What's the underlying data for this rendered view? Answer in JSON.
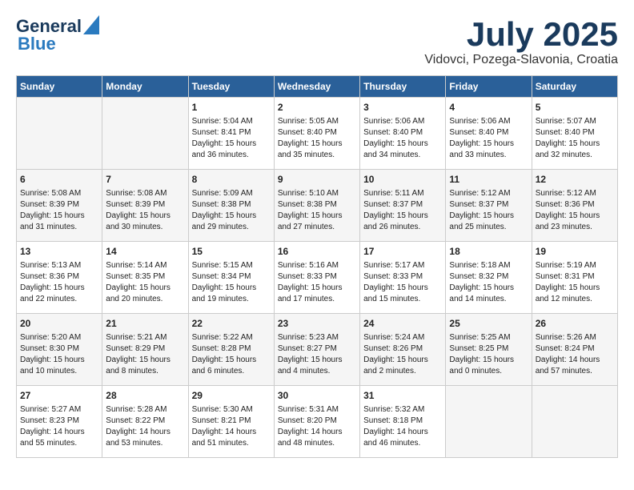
{
  "header": {
    "logo_line1": "General",
    "logo_line2": "Blue",
    "month_year": "July 2025",
    "location": "Vidovci, Pozega-Slavonia, Croatia"
  },
  "days_of_week": [
    "Sunday",
    "Monday",
    "Tuesday",
    "Wednesday",
    "Thursday",
    "Friday",
    "Saturday"
  ],
  "weeks": [
    [
      {
        "day": "",
        "empty": true
      },
      {
        "day": "",
        "empty": true
      },
      {
        "day": "1",
        "sunrise": "Sunrise: 5:04 AM",
        "sunset": "Sunset: 8:41 PM",
        "daylight": "Daylight: 15 hours and 36 minutes."
      },
      {
        "day": "2",
        "sunrise": "Sunrise: 5:05 AM",
        "sunset": "Sunset: 8:40 PM",
        "daylight": "Daylight: 15 hours and 35 minutes."
      },
      {
        "day": "3",
        "sunrise": "Sunrise: 5:06 AM",
        "sunset": "Sunset: 8:40 PM",
        "daylight": "Daylight: 15 hours and 34 minutes."
      },
      {
        "day": "4",
        "sunrise": "Sunrise: 5:06 AM",
        "sunset": "Sunset: 8:40 PM",
        "daylight": "Daylight: 15 hours and 33 minutes."
      },
      {
        "day": "5",
        "sunrise": "Sunrise: 5:07 AM",
        "sunset": "Sunset: 8:40 PM",
        "daylight": "Daylight: 15 hours and 32 minutes."
      }
    ],
    [
      {
        "day": "6",
        "sunrise": "Sunrise: 5:08 AM",
        "sunset": "Sunset: 8:39 PM",
        "daylight": "Daylight: 15 hours and 31 minutes."
      },
      {
        "day": "7",
        "sunrise": "Sunrise: 5:08 AM",
        "sunset": "Sunset: 8:39 PM",
        "daylight": "Daylight: 15 hours and 30 minutes."
      },
      {
        "day": "8",
        "sunrise": "Sunrise: 5:09 AM",
        "sunset": "Sunset: 8:38 PM",
        "daylight": "Daylight: 15 hours and 29 minutes."
      },
      {
        "day": "9",
        "sunrise": "Sunrise: 5:10 AM",
        "sunset": "Sunset: 8:38 PM",
        "daylight": "Daylight: 15 hours and 27 minutes."
      },
      {
        "day": "10",
        "sunrise": "Sunrise: 5:11 AM",
        "sunset": "Sunset: 8:37 PM",
        "daylight": "Daylight: 15 hours and 26 minutes."
      },
      {
        "day": "11",
        "sunrise": "Sunrise: 5:12 AM",
        "sunset": "Sunset: 8:37 PM",
        "daylight": "Daylight: 15 hours and 25 minutes."
      },
      {
        "day": "12",
        "sunrise": "Sunrise: 5:12 AM",
        "sunset": "Sunset: 8:36 PM",
        "daylight": "Daylight: 15 hours and 23 minutes."
      }
    ],
    [
      {
        "day": "13",
        "sunrise": "Sunrise: 5:13 AM",
        "sunset": "Sunset: 8:36 PM",
        "daylight": "Daylight: 15 hours and 22 minutes."
      },
      {
        "day": "14",
        "sunrise": "Sunrise: 5:14 AM",
        "sunset": "Sunset: 8:35 PM",
        "daylight": "Daylight: 15 hours and 20 minutes."
      },
      {
        "day": "15",
        "sunrise": "Sunrise: 5:15 AM",
        "sunset": "Sunset: 8:34 PM",
        "daylight": "Daylight: 15 hours and 19 minutes."
      },
      {
        "day": "16",
        "sunrise": "Sunrise: 5:16 AM",
        "sunset": "Sunset: 8:33 PM",
        "daylight": "Daylight: 15 hours and 17 minutes."
      },
      {
        "day": "17",
        "sunrise": "Sunrise: 5:17 AM",
        "sunset": "Sunset: 8:33 PM",
        "daylight": "Daylight: 15 hours and 15 minutes."
      },
      {
        "day": "18",
        "sunrise": "Sunrise: 5:18 AM",
        "sunset": "Sunset: 8:32 PM",
        "daylight": "Daylight: 15 hours and 14 minutes."
      },
      {
        "day": "19",
        "sunrise": "Sunrise: 5:19 AM",
        "sunset": "Sunset: 8:31 PM",
        "daylight": "Daylight: 15 hours and 12 minutes."
      }
    ],
    [
      {
        "day": "20",
        "sunrise": "Sunrise: 5:20 AM",
        "sunset": "Sunset: 8:30 PM",
        "daylight": "Daylight: 15 hours and 10 minutes."
      },
      {
        "day": "21",
        "sunrise": "Sunrise: 5:21 AM",
        "sunset": "Sunset: 8:29 PM",
        "daylight": "Daylight: 15 hours and 8 minutes."
      },
      {
        "day": "22",
        "sunrise": "Sunrise: 5:22 AM",
        "sunset": "Sunset: 8:28 PM",
        "daylight": "Daylight: 15 hours and 6 minutes."
      },
      {
        "day": "23",
        "sunrise": "Sunrise: 5:23 AM",
        "sunset": "Sunset: 8:27 PM",
        "daylight": "Daylight: 15 hours and 4 minutes."
      },
      {
        "day": "24",
        "sunrise": "Sunrise: 5:24 AM",
        "sunset": "Sunset: 8:26 PM",
        "daylight": "Daylight: 15 hours and 2 minutes."
      },
      {
        "day": "25",
        "sunrise": "Sunrise: 5:25 AM",
        "sunset": "Sunset: 8:25 PM",
        "daylight": "Daylight: 15 hours and 0 minutes."
      },
      {
        "day": "26",
        "sunrise": "Sunrise: 5:26 AM",
        "sunset": "Sunset: 8:24 PM",
        "daylight": "Daylight: 14 hours and 57 minutes."
      }
    ],
    [
      {
        "day": "27",
        "sunrise": "Sunrise: 5:27 AM",
        "sunset": "Sunset: 8:23 PM",
        "daylight": "Daylight: 14 hours and 55 minutes."
      },
      {
        "day": "28",
        "sunrise": "Sunrise: 5:28 AM",
        "sunset": "Sunset: 8:22 PM",
        "daylight": "Daylight: 14 hours and 53 minutes."
      },
      {
        "day": "29",
        "sunrise": "Sunrise: 5:30 AM",
        "sunset": "Sunset: 8:21 PM",
        "daylight": "Daylight: 14 hours and 51 minutes."
      },
      {
        "day": "30",
        "sunrise": "Sunrise: 5:31 AM",
        "sunset": "Sunset: 8:20 PM",
        "daylight": "Daylight: 14 hours and 48 minutes."
      },
      {
        "day": "31",
        "sunrise": "Sunrise: 5:32 AM",
        "sunset": "Sunset: 8:18 PM",
        "daylight": "Daylight: 14 hours and 46 minutes."
      },
      {
        "day": "",
        "empty": true
      },
      {
        "day": "",
        "empty": true
      }
    ]
  ]
}
